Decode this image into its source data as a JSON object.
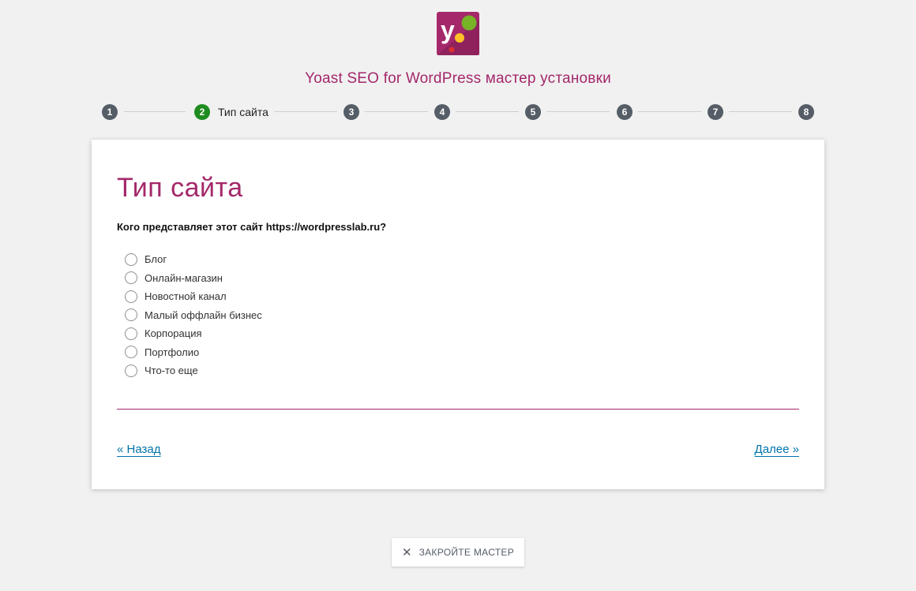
{
  "header": {
    "logo_icon": "yoast-logo-icon",
    "title": "Yoast SEO for WordPress мастер установки"
  },
  "stepper": {
    "steps": [
      "1",
      "2",
      "3",
      "4",
      "5",
      "6",
      "7",
      "8"
    ],
    "active_step": 2,
    "active_label": "Тип сайта",
    "active_color": "#1e8c1e",
    "inactive_color": "#555d66"
  },
  "card": {
    "title": "Тип сайта",
    "question": "Кого представляет этот сайт https://wordpresslab.ru?",
    "options": [
      "Блог",
      "Онлайн-магазин",
      "Новостной канал",
      "Малый оффлайн бизнес",
      "Корпорация",
      "Портфолио",
      "Что-то еще"
    ],
    "back_label": "« Назад",
    "next_label": "Далее »"
  },
  "footer": {
    "close_icon": "close-icon",
    "close_label": "ЗАКРОЙТЕ МАСТЕР"
  },
  "colors": {
    "brand": "#a4286a",
    "link": "#0073aa",
    "background": "#f1f1f1"
  }
}
